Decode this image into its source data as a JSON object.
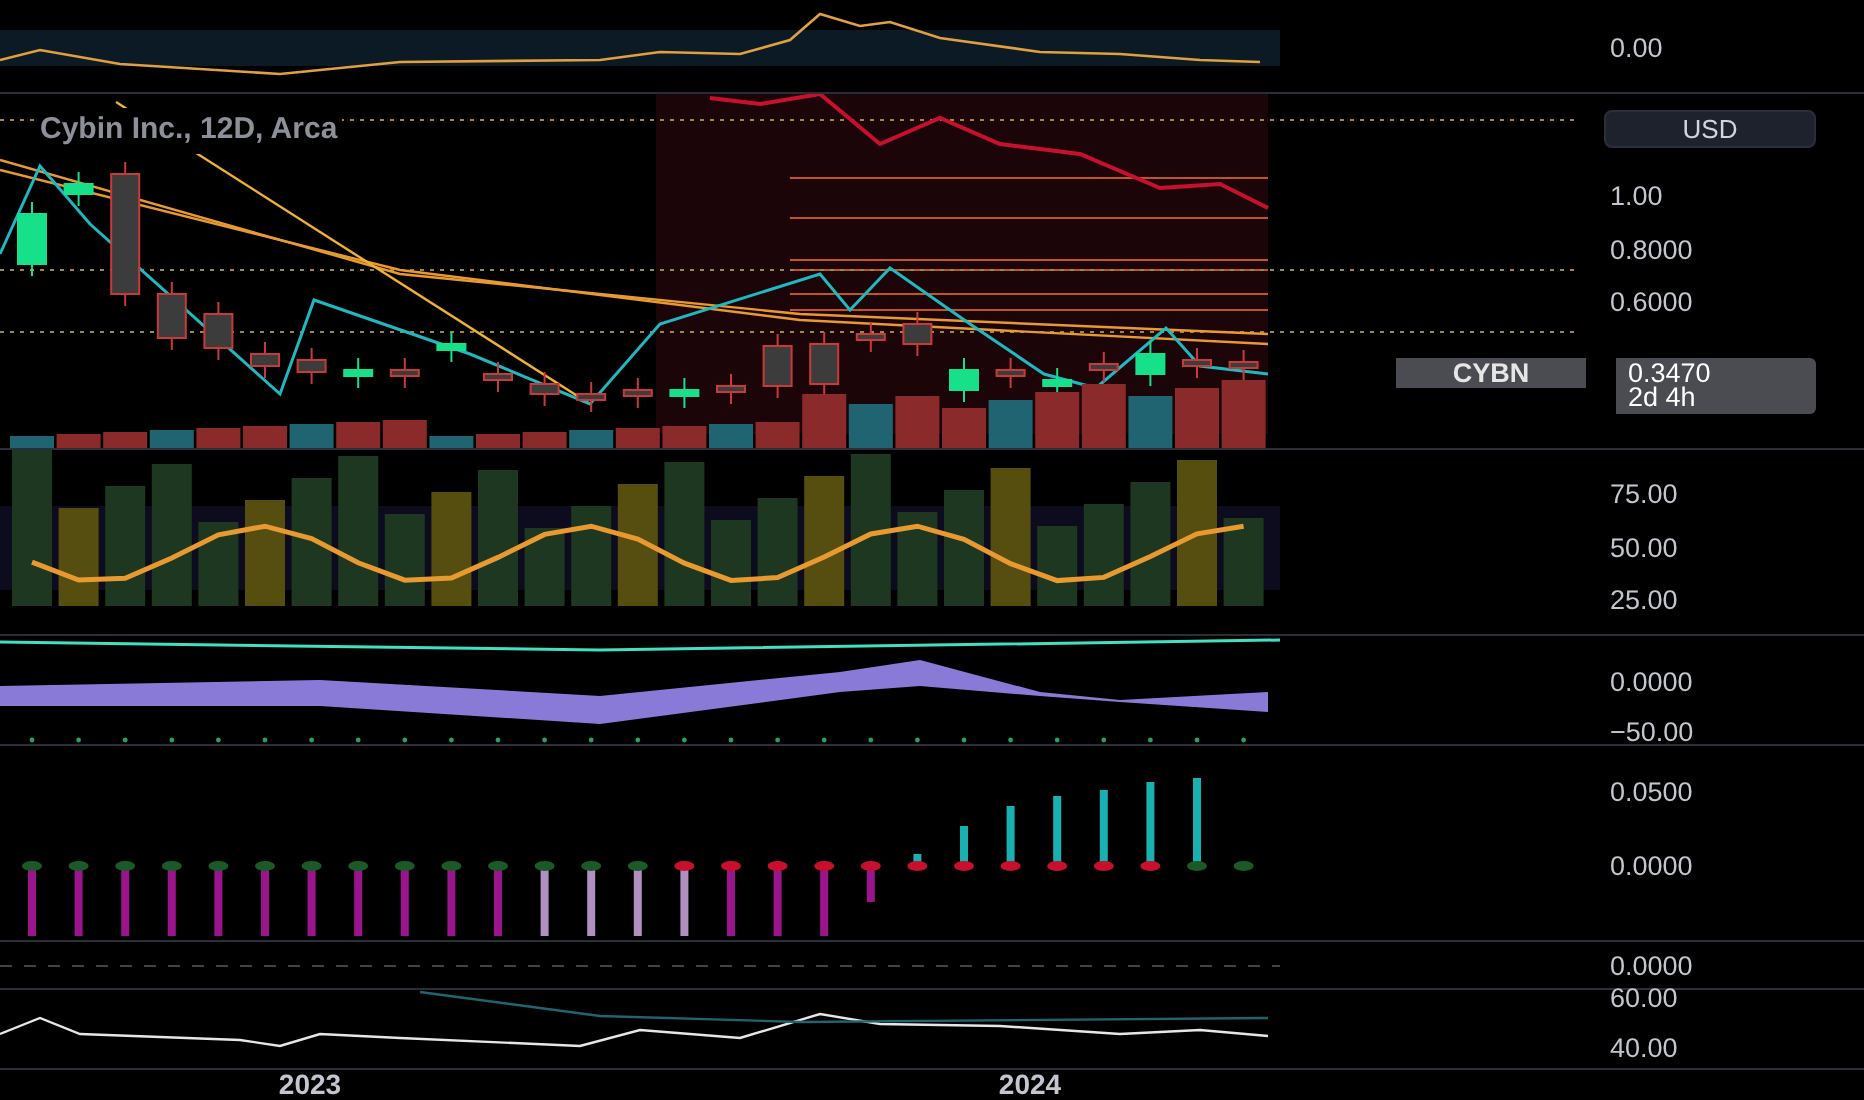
{
  "chart": {
    "title": "Cybin Inc., 12D, Arca",
    "currency_button": "USD",
    "symbol_tag": "CYBN",
    "last_price": "0.3470",
    "countdown": "2d 4h",
    "panes": [
      {
        "kind": "oscillator",
        "axis_labels": [
          "0.00"
        ]
      },
      {
        "kind": "price",
        "axis_labels": [
          "1.00",
          "0.8000",
          "0.6000"
        ]
      },
      {
        "kind": "rsi",
        "axis_labels": [
          "75.00",
          "50.00",
          "25.00"
        ]
      },
      {
        "kind": "bands",
        "axis_labels": [
          "0.0000",
          "−50.00"
        ]
      },
      {
        "kind": "histogram",
        "axis_labels": [
          "0.0500",
          "0.0000"
        ]
      },
      {
        "kind": "flat",
        "axis_labels": [
          "0.0000"
        ]
      },
      {
        "kind": "line",
        "axis_labels": [
          "60.00",
          "40.00"
        ]
      }
    ],
    "time_axis": [
      "2023",
      "2024"
    ]
  }
}
